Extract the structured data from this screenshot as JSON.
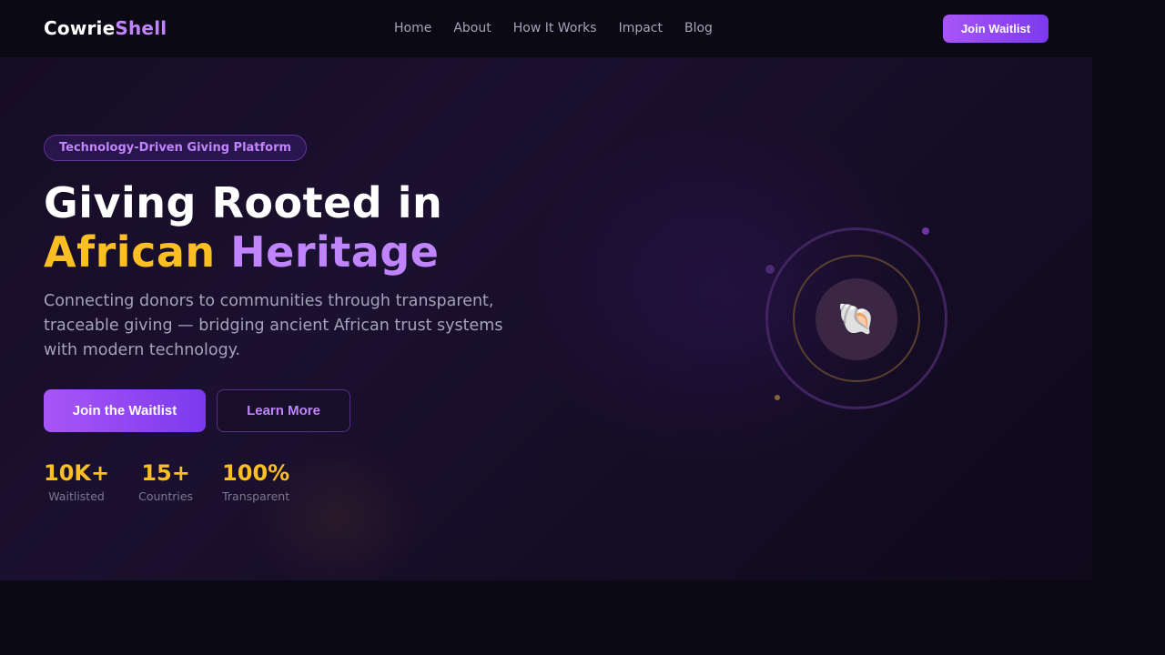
{
  "brand": {
    "part1": "Cowrie",
    "part2": "Shell"
  },
  "nav": {
    "items": [
      "Home",
      "About",
      "How It Works",
      "Impact",
      "Blog"
    ],
    "cta": "Join Waitlist"
  },
  "hero": {
    "badge": "Technology-Driven Giving Platform",
    "title_line1": "Giving Rooted in",
    "title_word_gold": "African",
    "title_word_violet": "Heritage",
    "lede": "Connecting donors to communities through transparent, traceable giving — bridging ancient African trust systems with modern technology.",
    "primary_cta": "Join the Waitlist",
    "secondary_cta": "Learn More",
    "emblem": "🐚",
    "emblem_icon": "spiral-shell-icon",
    "stats": [
      {
        "value": "10K+",
        "label": "Waitlisted"
      },
      {
        "value": "15+",
        "label": "Countries"
      },
      {
        "value": "100%",
        "label": "Transparent"
      }
    ]
  },
  "colors": {
    "background": "#0b0914",
    "accent_violet": "#a855f7",
    "accent_gold": "#fbbf24",
    "text_muted": "#a3a3bb"
  }
}
